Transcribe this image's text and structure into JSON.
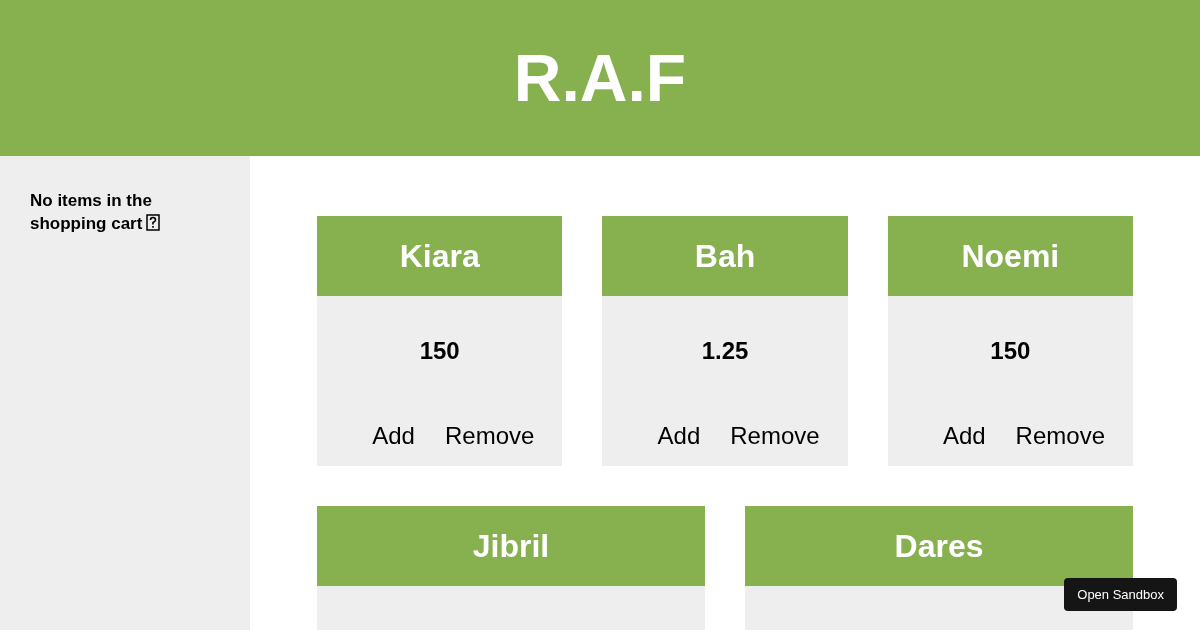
{
  "header": {
    "title": "R.A.F"
  },
  "cart": {
    "message": "No items in the shopping cart"
  },
  "product_rows": [
    {
      "products": [
        {
          "name": "Kiara",
          "price": "150",
          "actions": [
            "Add",
            "Remove"
          ]
        },
        {
          "name": "Bah",
          "price": "1.25",
          "actions": [
            "Add",
            "Remove"
          ]
        },
        {
          "name": "Noemi",
          "price": "150",
          "actions": [
            "Add",
            "Remove"
          ]
        }
      ]
    },
    {
      "products": [
        {
          "name": "Jibril"
        },
        {
          "name": "Dares"
        }
      ]
    }
  ],
  "sandbox_button": {
    "label": "Open Sandbox"
  }
}
